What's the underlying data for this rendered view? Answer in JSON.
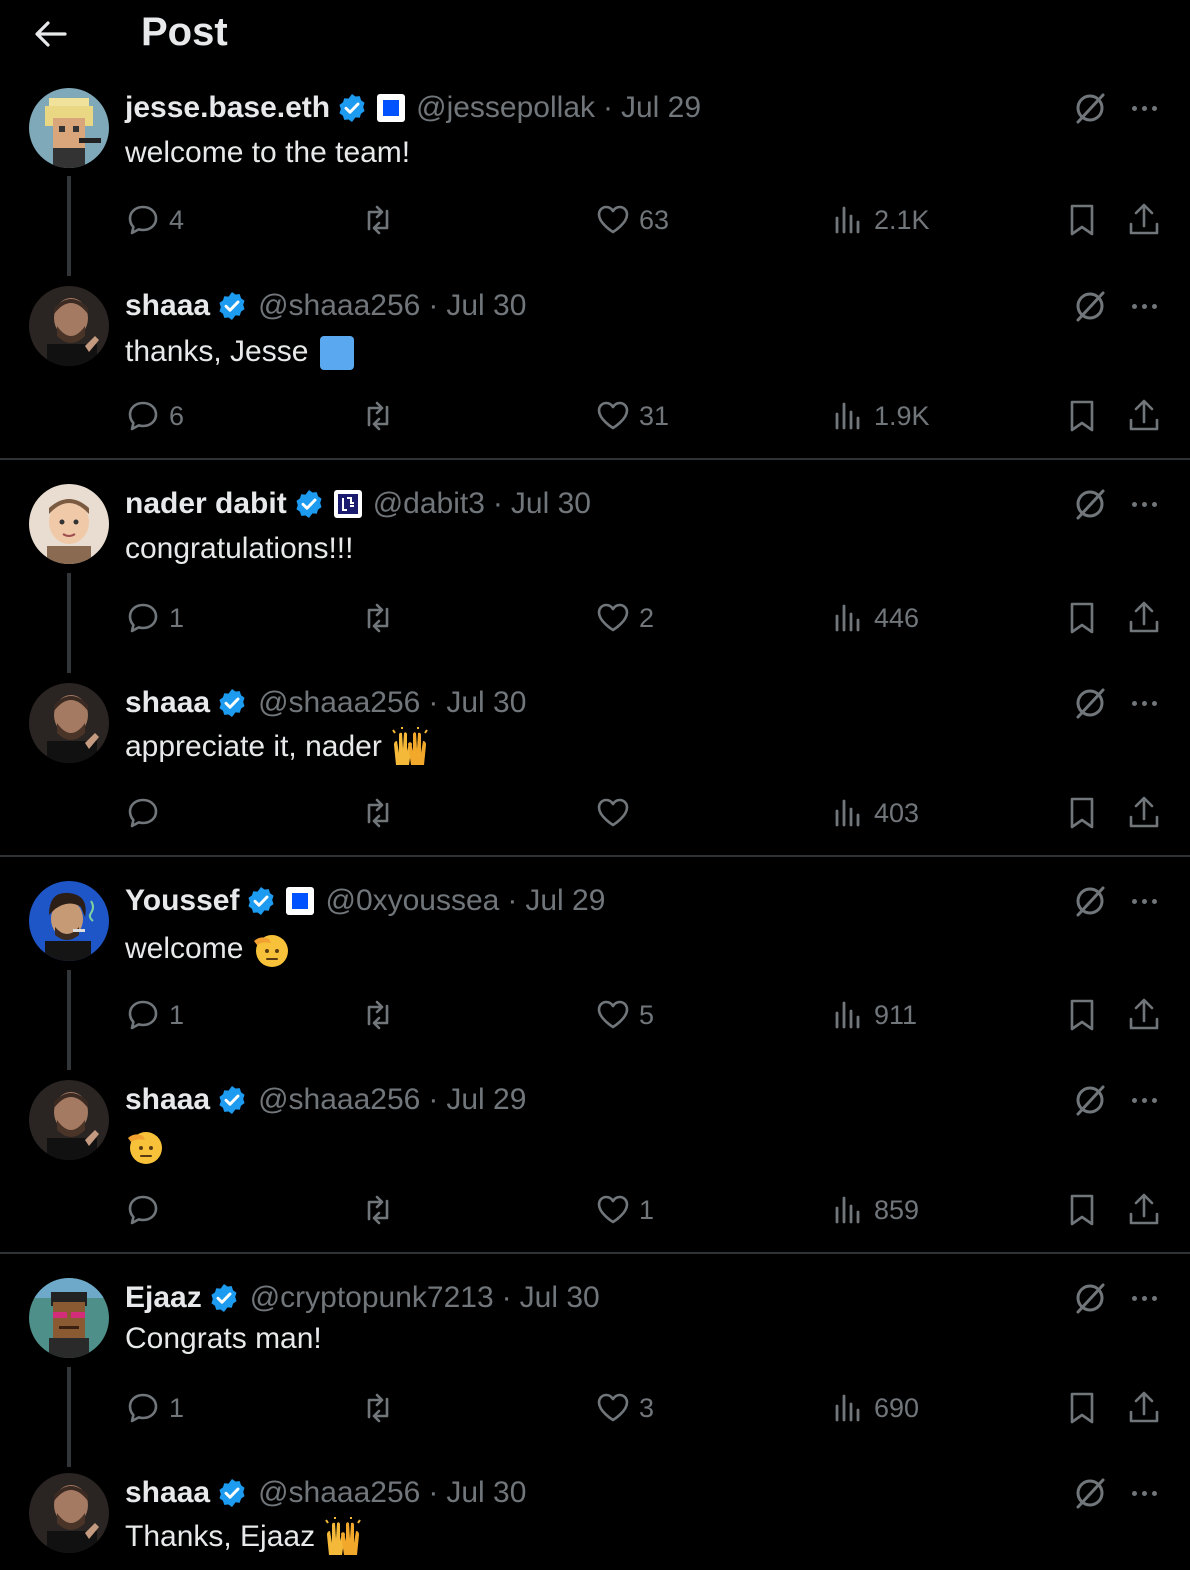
{
  "header": {
    "title": "Post",
    "back_icon": "arrow-left-icon"
  },
  "colors": {
    "background": "#000000",
    "text": "#e7e9ea",
    "muted": "#71767b",
    "verified": "#1d9bf0",
    "divider": "#2f3336"
  },
  "threads": [
    {
      "posts": [
        {
          "name": "jesse.base.eth",
          "affiliation": "blue-square-badge",
          "handle": "@jessepollak",
          "date": "Jul 29",
          "text": "welcome to the team!",
          "emoji": "",
          "replies": "4",
          "likes": "63",
          "views": "2.1K"
        },
        {
          "name": "shaaa",
          "affiliation": "",
          "handle": "@shaaa256",
          "date": "Jul 30",
          "text": "thanks, Jesse",
          "emoji": "blue-square-emoji",
          "replies": "6",
          "likes": "31",
          "views": "1.9K"
        }
      ]
    },
    {
      "posts": [
        {
          "name": "nader dabit",
          "affiliation": "eigenlayer-badge",
          "handle": "@dabit3",
          "date": "Jul 30",
          "text": "congratulations!!!",
          "emoji": "",
          "replies": "1",
          "likes": "2",
          "views": "446"
        },
        {
          "name": "shaaa",
          "affiliation": "",
          "handle": "@shaaa256",
          "date": "Jul 30",
          "text": "appreciate it, nader",
          "emoji": "raising-hands-emoji",
          "replies": "",
          "likes": "",
          "views": "403"
        }
      ]
    },
    {
      "posts": [
        {
          "name": "Youssef",
          "affiliation": "blue-square-badge",
          "handle": "@0xyoussea",
          "date": "Jul 29",
          "text": "welcome",
          "emoji": "saluting-face-emoji",
          "replies": "1",
          "likes": "5",
          "views": "911"
        },
        {
          "name": "shaaa",
          "affiliation": "",
          "handle": "@shaaa256",
          "date": "Jul 29",
          "text": "",
          "emoji": "saluting-face-emoji",
          "replies": "",
          "likes": "1",
          "views": "859"
        }
      ]
    },
    {
      "posts": [
        {
          "name": "Ejaaz",
          "affiliation": "",
          "handle": "@cryptopunk7213",
          "date": "Jul 30",
          "text": "Congrats man!",
          "emoji": "",
          "replies": "1",
          "likes": "3",
          "views": "690"
        },
        {
          "name": "shaaa",
          "affiliation": "",
          "handle": "@shaaa256",
          "date": "Jul 30",
          "text": "Thanks, Ejaaz",
          "emoji": "raising-hands-emoji",
          "replies": "",
          "likes": "",
          "views": ""
        }
      ]
    }
  ],
  "separator": "·"
}
